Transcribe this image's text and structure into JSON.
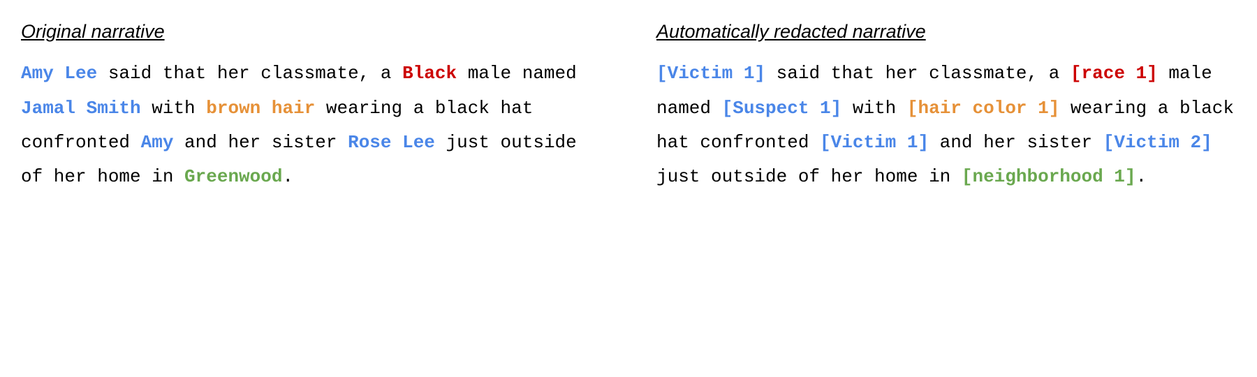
{
  "colors": {
    "name": "#4a86e8",
    "race": "#cc0000",
    "hair": "#e69138",
    "place": "#6aa84f"
  },
  "left": {
    "heading": "Original narrative",
    "segments": [
      {
        "text": "Amy Lee",
        "style": "hl c-blue",
        "role": "victim-name"
      },
      {
        "text": " said that her classmate, a ",
        "style": "c-black",
        "role": "plain"
      },
      {
        "text": "Black",
        "style": "hl c-red",
        "role": "race"
      },
      {
        "text": " male named ",
        "style": "c-black",
        "role": "plain"
      },
      {
        "text": "Jamal Smith",
        "style": "hl c-blue",
        "role": "suspect-name"
      },
      {
        "text": " with ",
        "style": "c-black",
        "role": "plain"
      },
      {
        "text": "brown hair",
        "style": "hl c-orange",
        "role": "hair"
      },
      {
        "text": " wearing a black hat confronted ",
        "style": "c-black",
        "role": "plain"
      },
      {
        "text": "Amy",
        "style": "hl c-blue",
        "role": "victim-name"
      },
      {
        "text": " and her sister ",
        "style": "c-black",
        "role": "plain"
      },
      {
        "text": "Rose Lee",
        "style": "hl c-blue",
        "role": "victim-name"
      },
      {
        "text": " just outside of her home in ",
        "style": "c-black",
        "role": "plain"
      },
      {
        "text": "Greenwood",
        "style": "hl c-green",
        "role": "neighborhood"
      },
      {
        "text": ".",
        "style": "c-black",
        "role": "plain"
      }
    ]
  },
  "right": {
    "heading": "Automatically redacted narrative",
    "segments": [
      {
        "text": "[Victim 1]",
        "style": "hl c-blue",
        "role": "victim-tag"
      },
      {
        "text": " said that her classmate, a ",
        "style": "c-black",
        "role": "plain"
      },
      {
        "text": "[race 1]",
        "style": "hl c-red",
        "role": "race-tag"
      },
      {
        "text": " male named ",
        "style": "c-black",
        "role": "plain"
      },
      {
        "text": "[Suspect 1]",
        "style": "hl c-blue",
        "role": "suspect-tag"
      },
      {
        "text": " with ",
        "style": "c-black",
        "role": "plain"
      },
      {
        "text": "[hair color 1]",
        "style": "hl c-orange",
        "role": "hair-tag"
      },
      {
        "text": " wearing a black hat confronted ",
        "style": "c-black",
        "role": "plain"
      },
      {
        "text": "[Victim 1]",
        "style": "hl c-blue",
        "role": "victim-tag"
      },
      {
        "text": " and her sister ",
        "style": "c-black",
        "role": "plain"
      },
      {
        "text": "[Victim 2]",
        "style": "hl c-blue",
        "role": "victim-tag"
      },
      {
        "text": " just outside of her home in ",
        "style": "c-black",
        "role": "plain"
      },
      {
        "text": "[neighborhood 1]",
        "style": "hl c-green",
        "role": "neighborhood-tag"
      },
      {
        "text": ".",
        "style": "c-black",
        "role": "plain"
      }
    ]
  }
}
